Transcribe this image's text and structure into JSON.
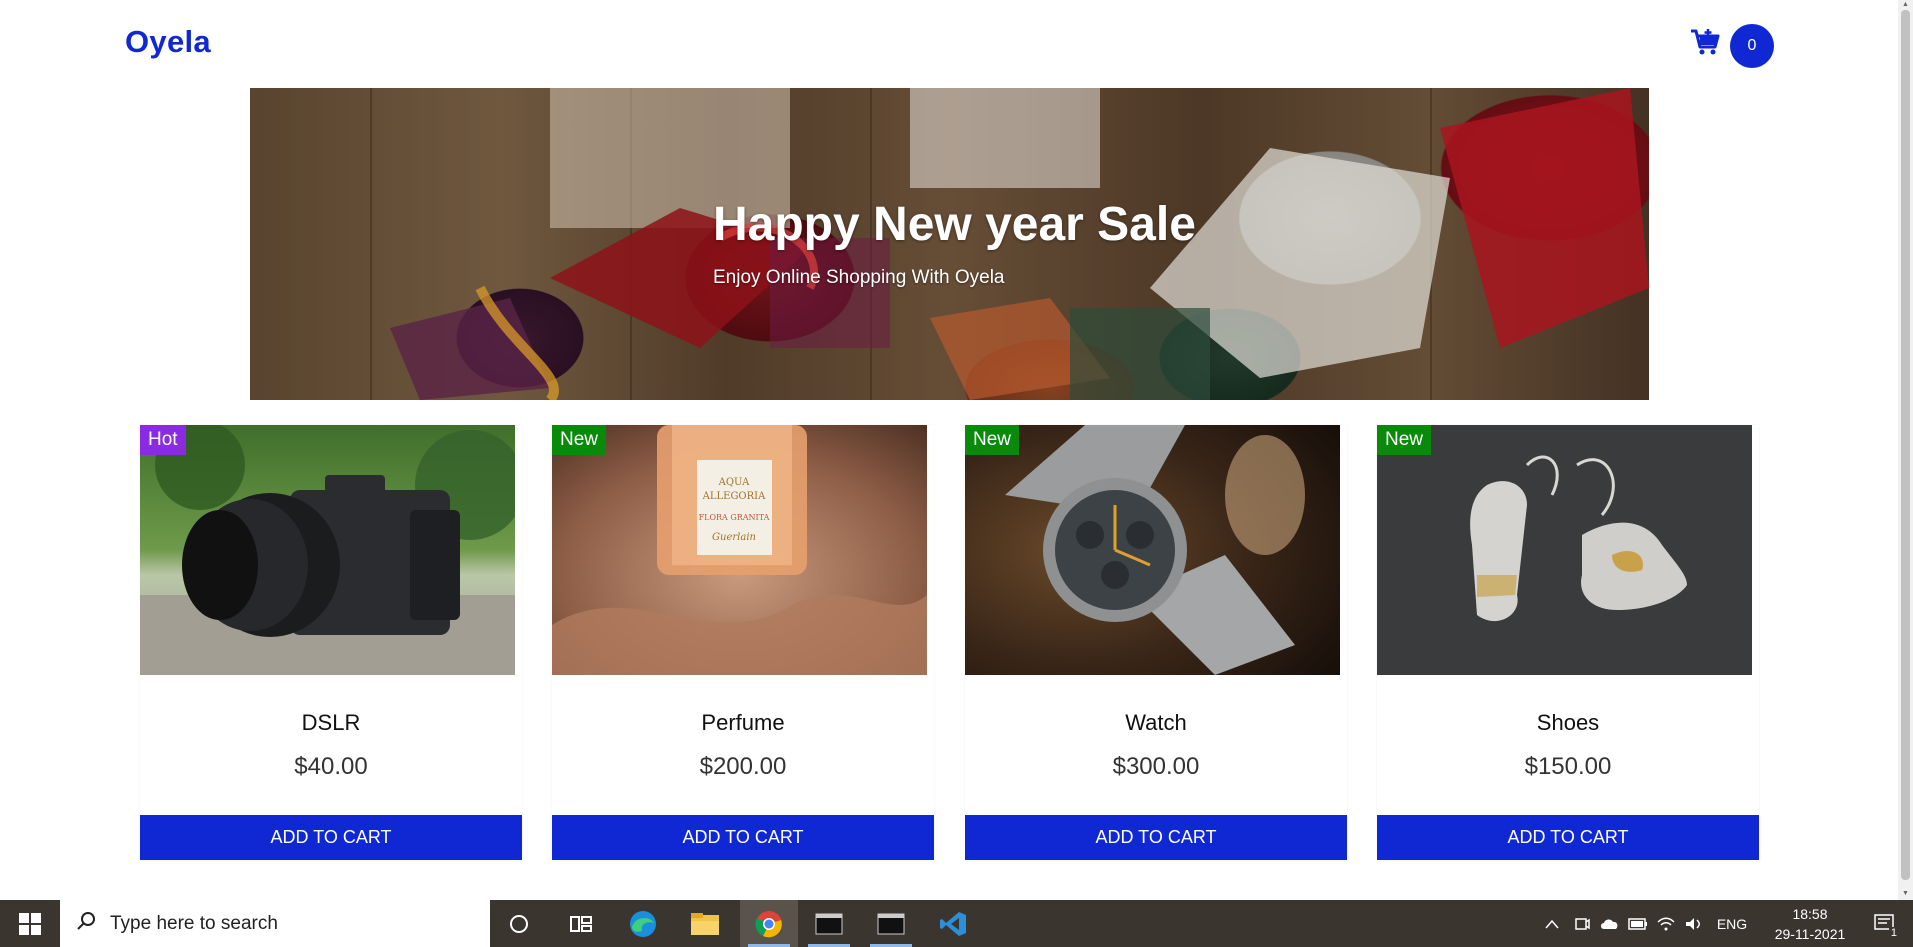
{
  "brand": "Oyela",
  "cart": {
    "count": "0"
  },
  "hero": {
    "title": "Happy New year Sale",
    "subtitle": "Enjoy Online Shopping With Oyela"
  },
  "products": [
    {
      "name": "DSLR",
      "price": "$40.00",
      "badge": "Hot",
      "button": "ADD TO CART"
    },
    {
      "name": "Perfume",
      "price": "$200.00",
      "badge": "New",
      "button": "ADD TO CART"
    },
    {
      "name": "Watch",
      "price": "$300.00",
      "badge": "New",
      "button": "ADD TO CART"
    },
    {
      "name": "Shoes",
      "price": "$150.00",
      "badge": "New",
      "button": "ADD TO CART"
    }
  ],
  "colors": {
    "accent": "#0f28d3",
    "hot_badge": "#8a2be2",
    "new_badge": "#0a8a0a",
    "taskbar": "#3b3530"
  },
  "taskbar": {
    "search_placeholder": "Type here to search",
    "language": "ENG",
    "time": "18:58",
    "date": "29-11-2021",
    "notification_count": "1",
    "apps": [
      "cortana-icon",
      "task-view-icon",
      "edge-icon",
      "file-explorer-icon",
      "chrome-icon",
      "terminal-icon",
      "terminal-icon",
      "vscode-icon"
    ]
  }
}
